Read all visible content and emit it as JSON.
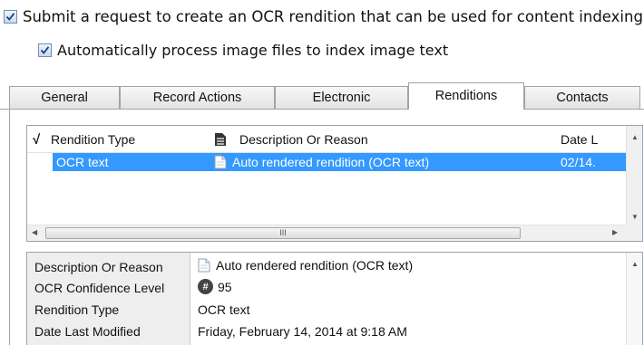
{
  "options": {
    "ocr_request": {
      "label": "Submit a request to create an OCR rendition that can be used for content indexing",
      "checked": true
    },
    "auto_process": {
      "label": "Automatically process image files to index image text",
      "checked": true
    }
  },
  "tabs": [
    {
      "label": "General",
      "active": false
    },
    {
      "label": "Record Actions",
      "active": false
    },
    {
      "label": "Electronic",
      "active": false
    },
    {
      "label": "Renditions",
      "active": true
    },
    {
      "label": "Contacts",
      "active": false
    }
  ],
  "renditions": {
    "check_header": "√",
    "columns": {
      "type": "Rendition Type",
      "description": "Description Or Reason",
      "date": "Date L"
    },
    "rows": [
      {
        "type": "OCR text",
        "description": "Auto rendered rendition (OCR text)",
        "date": "02/14."
      }
    ],
    "scroll_grip": "III"
  },
  "properties": {
    "description": {
      "label": "Description Or Reason",
      "value": "Auto rendered rendition (OCR text)"
    },
    "confidence": {
      "label": "OCR Confidence Level",
      "value": "95",
      "icon": "hash-icon"
    },
    "rendition_type": {
      "label": "Rendition Type",
      "value": "OCR text"
    },
    "date_modified": {
      "label": "Date Last Modified",
      "value": "Friday, February 14, 2014 at 9:18 AM"
    }
  },
  "colors": {
    "selection": "#3399ff",
    "tab_border": "#a3a3a3",
    "label_panel": "#eeeeee"
  }
}
